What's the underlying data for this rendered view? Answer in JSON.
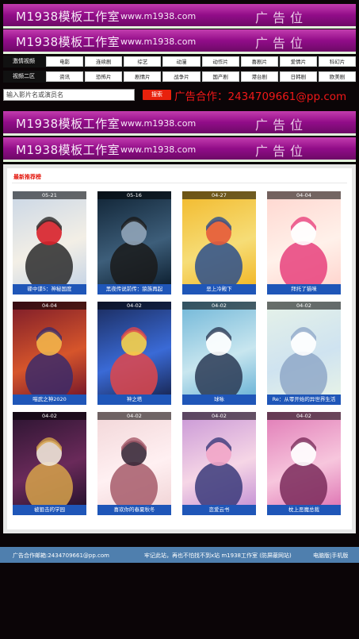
{
  "banners": [
    {
      "brand": "M1938模板工作室",
      "url": "www.m1938.com",
      "ad": "广告位"
    },
    {
      "brand": "M1938模板工作室",
      "url": "www.m1938.com",
      "ad": "广告位"
    },
    {
      "brand": "M1938模板工作室",
      "url": "www.m1938.com",
      "ad": "广告位"
    },
    {
      "brand": "M1938模板工作室",
      "url": "www.m1938.com",
      "ad": "广告位"
    }
  ],
  "nav": {
    "row1": {
      "label": "激情视频",
      "items": [
        "电影",
        "连续剧",
        "综艺",
        "动漫",
        "动作片",
        "喜剧片",
        "爱情片",
        "科幻片"
      ]
    },
    "row2": {
      "label": "视频二区",
      "items": [
        "资讯",
        "恐怖片",
        "剧情片",
        "战争片",
        "国产剧",
        "港台剧",
        "日韩剧",
        "欧美剧"
      ]
    }
  },
  "search": {
    "placeholder": "输入影片名或演员名",
    "button": "搜索",
    "contact": "广告合作：2434709661@pp.com"
  },
  "section": {
    "title": "最新推荐榜"
  },
  "cards": [
    {
      "date": "05-21",
      "title": "碟中谍5：神秘国度"
    },
    {
      "date": "05-16",
      "title": "黑夜传说前传：狼族再起"
    },
    {
      "date": "04-27",
      "title": "恶上冷殿下"
    },
    {
      "date": "04-04",
      "title": "拜托了猫咪"
    },
    {
      "date": "04-04",
      "title": "喵武之神2020"
    },
    {
      "date": "04-02",
      "title": "神之塔"
    },
    {
      "date": "04-02",
      "title": "球咏"
    },
    {
      "date": "04-02",
      "title": "Re：从零开始的异世界生活"
    },
    {
      "date": "04-02",
      "title": "被狙击的学园"
    },
    {
      "date": "04-02",
      "title": "喜欢你的春夏秋冬"
    },
    {
      "date": "04-02",
      "title": "恋爱云书"
    },
    {
      "date": "04-02",
      "title": "枕上恶魔总裁"
    }
  ],
  "footer": {
    "email": "广告合作邮箱:2434709661@pp.com",
    "notice": "牢记此站，再也不怕找不到x站 m1938工作室 (防屏蔽网站)",
    "switch": "电脑版|手机版"
  }
}
